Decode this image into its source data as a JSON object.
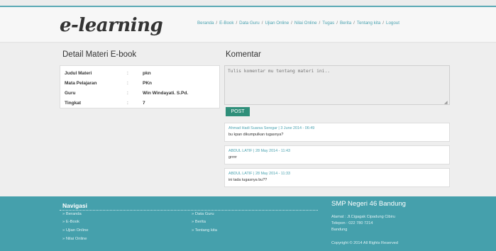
{
  "header": {
    "logo": "e-learning",
    "nav": [
      "Beranda",
      "E-Book",
      "Data Guru",
      "Ujian Online",
      "Nilai Online",
      "Tugas",
      "Berita",
      "Tentang kita",
      "Logout"
    ],
    "nav_separator": "/"
  },
  "detail": {
    "title": "Detail Materi E-book",
    "rows": [
      {
        "label": "Judul Materi",
        "colon": ":",
        "value": "pkn"
      },
      {
        "label": "Mata Pelajaran",
        "colon": ":",
        "value": "PKn"
      },
      {
        "label": "Guru",
        "colon": ":",
        "value": "Win Windayati. S.Pd."
      },
      {
        "label": "Tingkat",
        "colon": ":",
        "value": "7"
      }
    ]
  },
  "comments": {
    "title": "Komentar",
    "placeholder": "Tulis komentar mu tentang materi ini..",
    "post_label": "POST",
    "items": [
      {
        "meta": "Ahmad Hadi Suarsa Seregar | 3 June 2014 - 06:49",
        "text": "bu kpan dikumpulkan tugasnya?"
      },
      {
        "meta": "ABDUL LATIF | 28 May 2014 - 11:43",
        "text": "grrrrr"
      },
      {
        "meta": "ABDUL LATIF | 28 May 2014 - 11:33",
        "text": "ini tada tugasnya bu??"
      }
    ]
  },
  "footer": {
    "nav_title": "Navigasi",
    "links_col1": [
      "» Beranda",
      "» E-Book",
      "» Ujian Online",
      "» Nilai Online"
    ],
    "links_col2": [
      "» Data Guru",
      "» Berita",
      "» Tentang kita"
    ],
    "school_name": "SMP Negeri 46 Bandung",
    "address": "Alamat : Jl.Cigagak Cipadung Cibiru",
    "phone": "Telepon : 022 780 7214",
    "city": "Bandung",
    "copyright": "Copyright © 2014 All Rights Reserved"
  },
  "colors": {
    "accent": "#45a0ac",
    "post_button": "#2f8f7a",
    "link": "#4aa2b0"
  }
}
